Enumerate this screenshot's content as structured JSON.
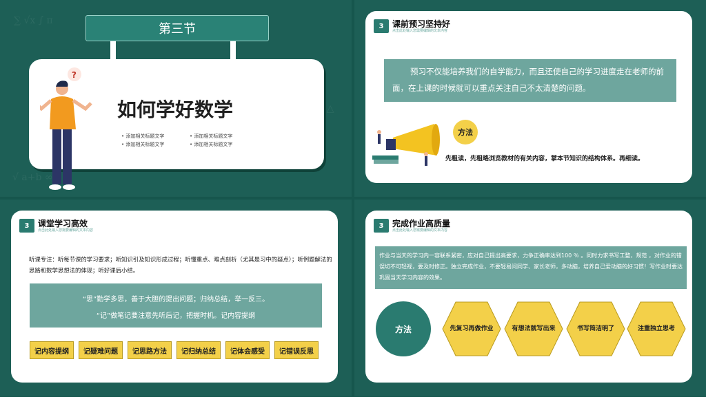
{
  "colors": {
    "background": "#1d5f56",
    "accent_teal": "#2a7b70",
    "box_teal": "#6ea69e",
    "accent_yellow": "#f3d049"
  },
  "slide1": {
    "banner": "第三节",
    "title": "如何学好数学",
    "subtitles": [
      "添加相关标题文字",
      "添加相关标题文字",
      "添加相关标题文字",
      "添加相关标题文字"
    ],
    "question_mark": "?"
  },
  "slide2": {
    "badge": "3",
    "title": "课前预习坚持好",
    "subtitle": "点击此处输入您需要编辑的文本内容",
    "paragraph": "预习不仅能培养我们的自学能力，而且还使自己的学习进度走在老师的前面，在上课的时候就可以重点关注自己不太清楚的问题。",
    "method_label": "方法",
    "method_text": "先粗读，先粗略浏览教材的有关内容，掌本节知识的结构体系。再细读。"
  },
  "slide3": {
    "badge": "3",
    "title": "课堂学习高效",
    "subtitle": "点击此处输入您需要编辑的文本内容",
    "paragraph": "听课专注：听每节课的学习要求；听知识引及知识形成过程；听懂重点、难点剖析（尤其是习中的疑点）；听例题解法的思路和数学思想法的体现；听好课后小结。",
    "box_line1": "“思”勤学多思，善于大胆的提出问题；归纳总结，举一反三。",
    "box_line2": "“记”做笔记要注意先听后记，把握时机。记内容提纲",
    "tags": [
      "记内容提纲",
      "记疑难问题",
      "记思路方法",
      "记归纳总结",
      "记体会感受",
      "记错误反思"
    ]
  },
  "slide4": {
    "badge": "3",
    "title": "完成作业高质量",
    "subtitle": "点击此处输入您需要编辑的文本内容",
    "paragraph": "作业与当天的学习内一容联系紧密，应对自己提出高要求，力争正确率达到100 ％ 。同时力求书写工整，规范 ，对作业的错误切不可轻视，要及时修正。独立完成作业，不要轻易问同学、家长老师，多动脑，培养自己爱动脑的好习惯！写作业时要达巩固当天学习内容的效果。",
    "method_label": "方法",
    "hexagons": [
      "先复习再做作业",
      "有想法就写出来",
      "书写简洁明了",
      "注重独立思考"
    ]
  }
}
